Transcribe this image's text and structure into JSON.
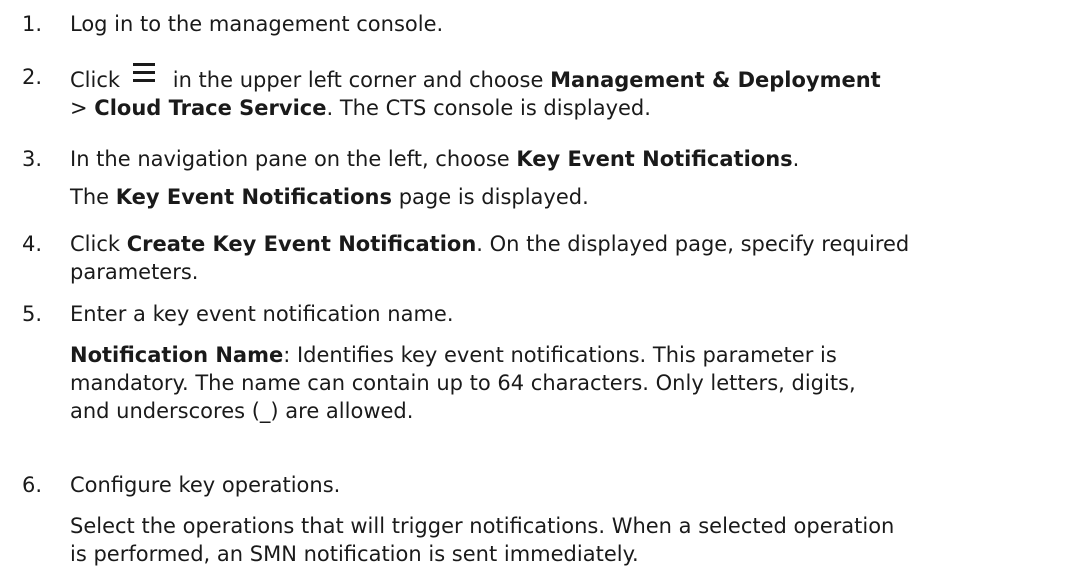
{
  "steps": [
    {
      "num": "1.",
      "text": "Log in to the management console."
    },
    {
      "num": "2.",
      "click": "Click",
      "icon": "menu-icon",
      "rest": "in the upper left corner and choose",
      "b1": "Management & Deployment",
      "l2_pre": ">",
      "b2": "Cloud Trace Service",
      "l2_post": ". The CTS console is displayed."
    },
    {
      "num": "3.",
      "pre": "In the navigation pane on the left, choose",
      "b": "Key Event Notifications",
      "post": ".",
      "p_b": "Key Event Notifications",
      "p_post": "page is displayed.",
      "p_pre": "The"
    },
    {
      "num": "4.",
      "pre": "Click",
      "b": "Create Key Event Notification",
      "post": ". On the displayed page, specify required",
      "l2": "parameters."
    },
    {
      "num": "5.",
      "text": "Enter a key event notification name.",
      "p_b": "Notification Name",
      "p_l1": ": Identifies key event notifications. This parameter is",
      "p_l2": "mandatory. The name can contain up to 64 characters. Only letters, digits,",
      "p_l3": "and underscores (_) are allowed."
    },
    {
      "num": "6.",
      "text": "Configure key operations.",
      "p_l1": "Select the operations that will trigger notifications. When a selected operation",
      "p_l2": "is performed, an SMN notification is sent immediately."
    }
  ]
}
